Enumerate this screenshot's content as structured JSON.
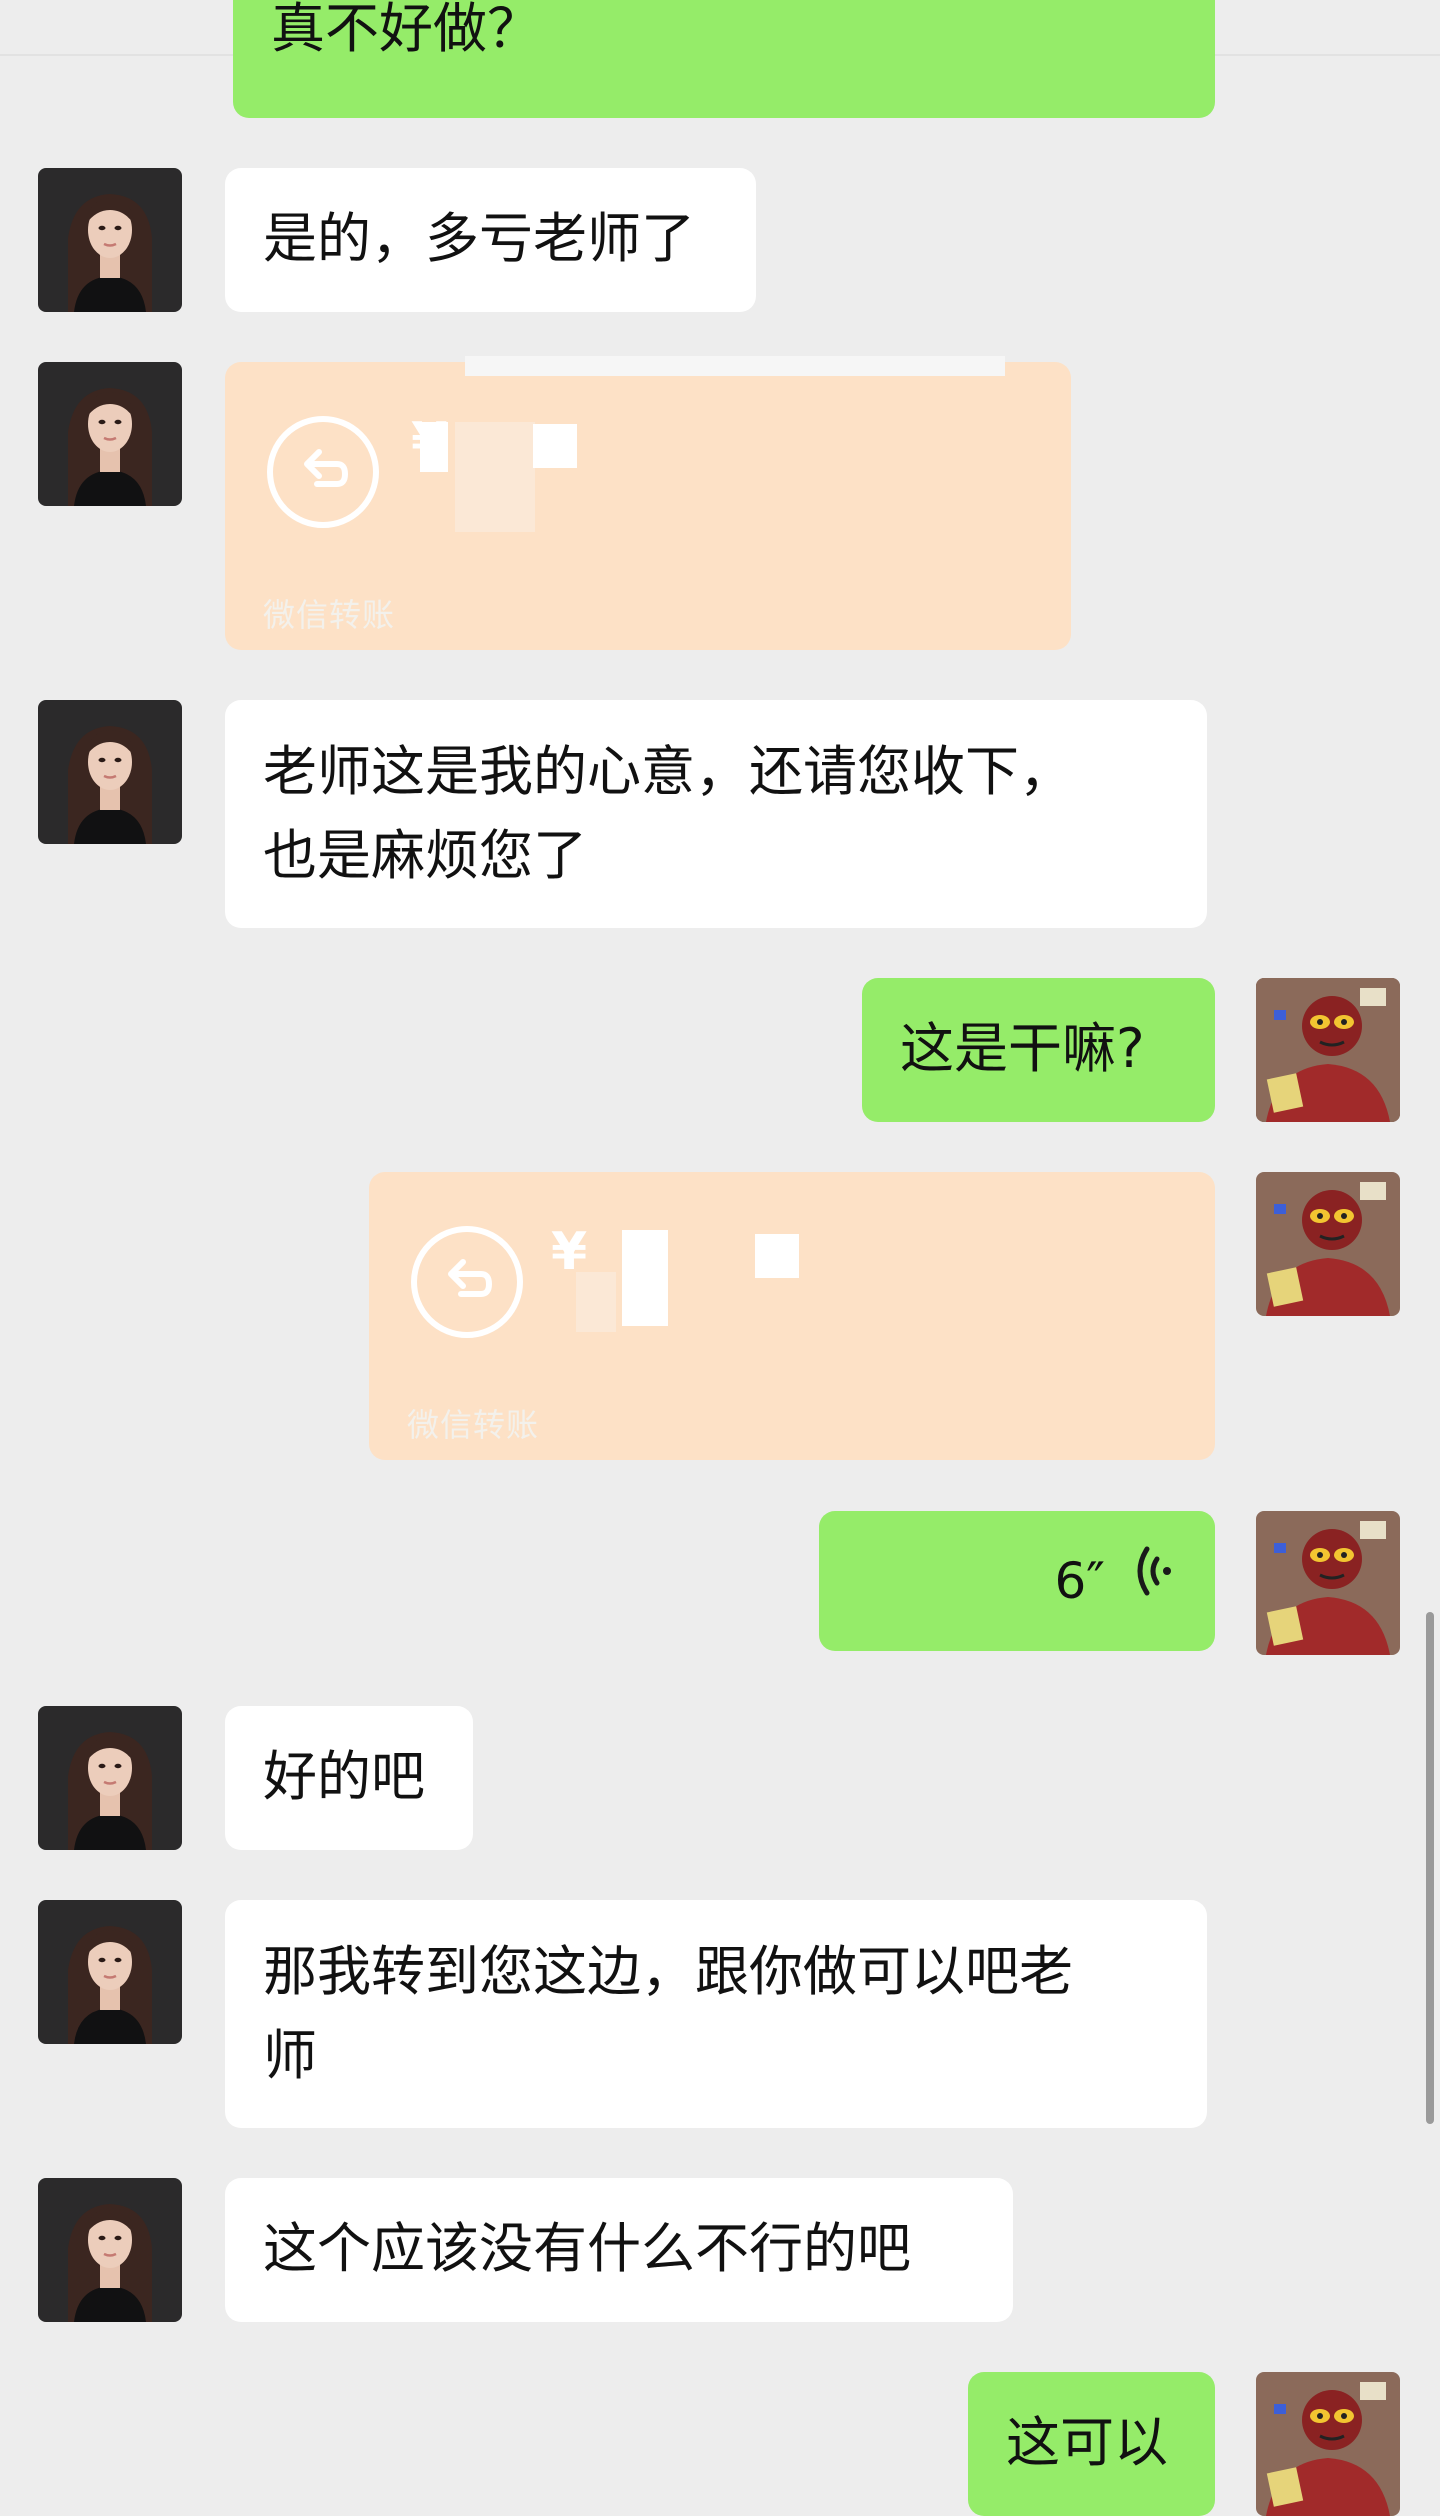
{
  "messages": [
    {
      "side": "right",
      "type": "text",
      "text": "真不好做？"
    },
    {
      "side": "left",
      "type": "text",
      "text": "是的，多亏老师了"
    },
    {
      "side": "left",
      "type": "transfer",
      "label": "微信转账"
    },
    {
      "side": "left",
      "type": "text",
      "line1": "老师这是我的心意，还请您收下，",
      "line2": "也是麻烦您了"
    },
    {
      "side": "right",
      "type": "text",
      "text": "这是干嘛?"
    },
    {
      "side": "right",
      "type": "transfer",
      "label": "微信转账"
    },
    {
      "side": "right",
      "type": "voice",
      "duration": "6″"
    },
    {
      "side": "left",
      "type": "text",
      "text": "好的吧"
    },
    {
      "side": "left",
      "type": "text",
      "line1": "那我转到您这边，跟你做可以吧老",
      "line2": "师"
    },
    {
      "side": "left",
      "type": "text",
      "text": "这个应该没有什么不行的吧"
    },
    {
      "side": "right",
      "type": "text",
      "text": "这可以"
    }
  ],
  "colors": {
    "background": "#ededed",
    "bubble_green": "#95ec69",
    "bubble_white": "#ffffff",
    "transfer_returned": "#fde1c6"
  },
  "icons": {
    "transfer": "return-arrow-icon",
    "voice": "voice-wave-icon"
  }
}
